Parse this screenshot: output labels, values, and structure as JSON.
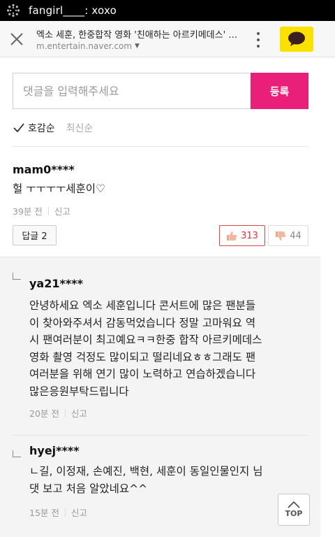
{
  "status_bar": {
    "notification": "fangirl____: xoxo",
    "icon": "spinner-icon"
  },
  "browser": {
    "title": "엑소 세훈, 한중합작 영화 '친애하는 아르키메데스' 캐스팅",
    "url": "m.entertain.naver.com",
    "close_icon": "close-icon",
    "more_icon": "more-vertical-icon",
    "share_icon": "kakaotalk-icon",
    "share_color": "#fae100"
  },
  "comment_form": {
    "placeholder": "댓글을 입력해주세요",
    "submit_label": "등록",
    "submit_color": "#ea1f7a"
  },
  "sort": {
    "active": "호감순",
    "inactive": "최신순"
  },
  "comments": [
    {
      "user": "mam0****",
      "text": "헐 ㅜㅜㅜㅜ세훈이♡",
      "time": "39분 전",
      "report": "신고",
      "reply_label": "답글 2",
      "likes": "313",
      "dislikes": "44"
    }
  ],
  "replies": [
    {
      "user": "ya21****",
      "lines": [
        "안녕하세요 엑소 세훈입니다 콘서트에 많은 팬분들",
        "이 찾아와주셔서 감동먹었습니다 정말 고마워요 역",
        "시 팬여러분이 최고예요ㅋㅋ한중 합작 아르키메데스",
        "영화 촬영 걱정도 많이되고 떨리네요ㅎㅎ그래도 팬",
        "여러분을 위해 연기 많이 노력하고 연습하겠습니다",
        "많은응원부탁드립니다"
      ],
      "time": "20분 전",
      "report": "신고"
    },
    {
      "user": "hyej****",
      "lines": [
        "ㄴ길, 이정재, 손예진, 백현, 세훈이 동일인물인지 님",
        "댓 보고 처음 알았네요^^"
      ],
      "time": "15분 전",
      "report": "신고"
    }
  ],
  "top_button": {
    "label": "TOP"
  }
}
